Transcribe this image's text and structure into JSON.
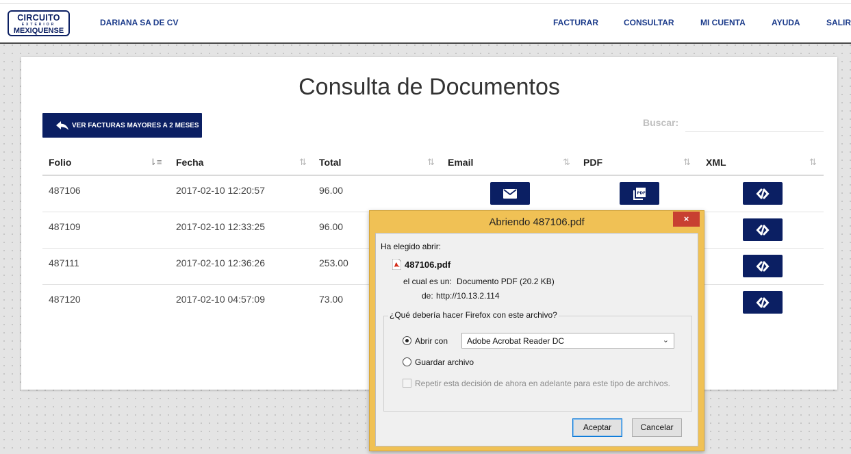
{
  "header": {
    "logo": {
      "line1": "CIRCUITO",
      "line2": "EXTERIOR",
      "line3": "MEXIQUENSE"
    },
    "company": "DARIANA SA DE CV",
    "nav": [
      "FACTURAR",
      "CONSULTAR",
      "MI CUENTA",
      "AYUDA",
      "SALIR"
    ]
  },
  "page": {
    "title": "Consulta de Documentos",
    "back_button": "VER FACTURAS MAYORES A 2 MESES",
    "search_label": "Buscar:",
    "search_value": ""
  },
  "table": {
    "columns": [
      "Folio",
      "Fecha",
      "Total",
      "Email",
      "PDF",
      "XML"
    ],
    "rows": [
      {
        "folio": "487106",
        "fecha": "2017-02-10 12:20:57",
        "total": "96.00"
      },
      {
        "folio": "487109",
        "fecha": "2017-02-10 12:33:25",
        "total": "96.00"
      },
      {
        "folio": "487111",
        "fecha": "2017-02-10 12:36:26",
        "total": "253.00"
      },
      {
        "folio": "487120",
        "fecha": "2017-02-10 04:57:09",
        "total": "73.00"
      }
    ]
  },
  "dialog": {
    "title": "Abriendo 487106.pdf",
    "close": "×",
    "chosen_label": "Ha elegido abrir:",
    "filename": "487106.pdf",
    "type_label": "el cual es un:",
    "type_value": "Documento PDF (20.2 KB)",
    "from_label": "de:",
    "from_value": "http://10.13.2.114",
    "question": "¿Qué debería hacer Firefox con este archivo?",
    "open_with_label": "Abrir con",
    "open_with_app": "Adobe Acrobat Reader DC",
    "save_label": "Guardar archivo",
    "remember_label": "Repetir esta decisión de ahora en adelante para este tipo de archivos.",
    "ok": "Aceptar",
    "cancel": "Cancelar"
  },
  "colors": {
    "brand": "#0b1f63",
    "nav_text": "#1a3a8a",
    "dialog_frame": "#f0c155"
  },
  "icons": {
    "email": "envelope-icon",
    "pdf": "pdf-file-icon",
    "xml": "code-link-icon",
    "back": "reply-arrow-icon"
  }
}
